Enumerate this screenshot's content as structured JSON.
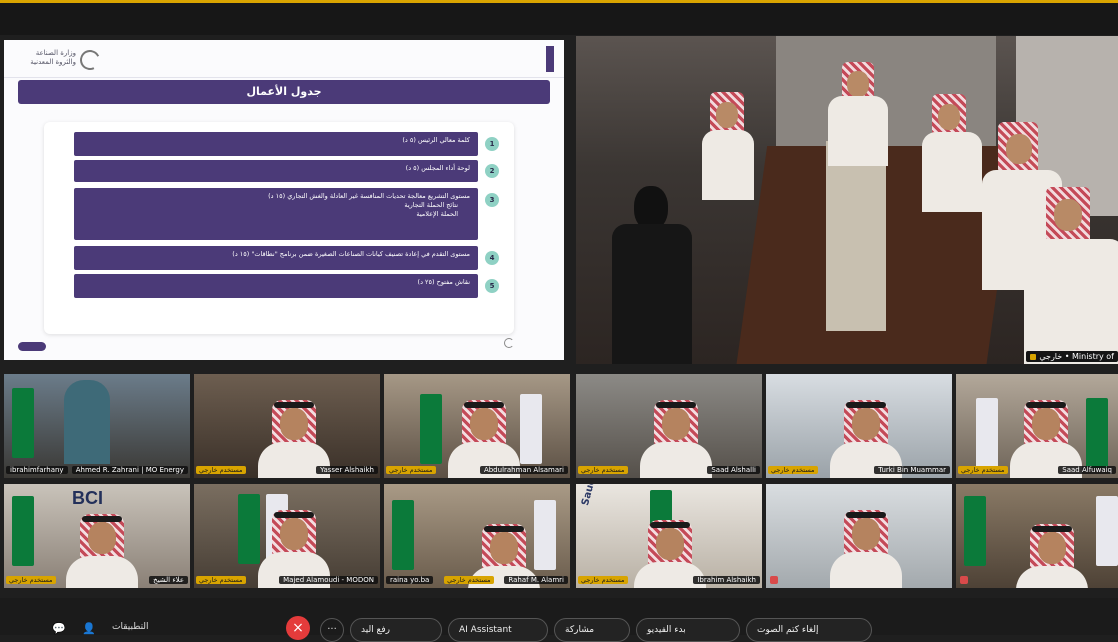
{
  "colors": {
    "accent": "#4b3a78",
    "badge": "#d8a400",
    "end_call": "#e43b3b"
  },
  "slide": {
    "logo_text_line1": "وزارة الصناعة",
    "logo_text_line2": "والثروة المعدنية",
    "title": "جدول الأعمال",
    "items": [
      {
        "num": "1",
        "text": "كلمة معالي الرئيس (٥ د)"
      },
      {
        "num": "2",
        "text": "لوحة أداء المجلس (٥ د)"
      },
      {
        "num": "3",
        "text": "مستوى التشريع معالجة تحديات المنافسة غير العادلة والغش التجاري (١٥ د)",
        "subs": [
          "نتائج الحملة التجارية",
          "الحملة الإعلامية"
        ]
      },
      {
        "num": "4",
        "text": "مستوى التقدم في إعادة تصنيف كيانات الصناعات الصغيرة ضمن برنامج \"نطاقات\" (١٥ د)"
      },
      {
        "num": "5",
        "text": "نقاش مفتوح (٢٥ د)"
      }
    ]
  },
  "main_video": {
    "label_role": "خارجي",
    "label_name": "Ministry of"
  },
  "participants": [
    {
      "name": "ibrahimfarhany",
      "role": "",
      "extra": "Ahmed R. Zahrani | MO Energy"
    },
    {
      "name": "Yasser Alshaikh",
      "role": "مستخدم خارجي"
    },
    {
      "name": "Abdulrahman Alsamari",
      "role": "مستخدم خارجي"
    },
    {
      "name": "Saad Alshalli",
      "role": "مستخدم خارجي"
    },
    {
      "name": "Turki Bin Muammar",
      "role": "مستخدم خارجي"
    },
    {
      "name": "Saad Alfuwaiq",
      "role": "مستخدم خارجي"
    },
    {
      "name": "علاء الشيخ",
      "role": "مستخدم خارجي",
      "logo": "BCI"
    },
    {
      "name": "Majed Alamoudi - MODON",
      "role": "مستخدم خارجي"
    },
    {
      "name": "Rahaf M. Alamri",
      "role": "مستخدم خارجي",
      "extra": "raina yo.ba"
    },
    {
      "name": "Ibrahim Alshaikh",
      "role": "مستخدم خارجي",
      "logo": "Saudi Ce"
    },
    {
      "name": "",
      "role": ""
    },
    {
      "name": "",
      "role": ""
    }
  ],
  "toolbar": {
    "apps_label": "التطبيقات",
    "mute_label": "إلغاء كتم الصوت",
    "video_label": "بدء الفيديو",
    "share_label": "مشاركة",
    "ai_label": "AI Assistant",
    "raise_label": "رفع اليد",
    "more_label": "···",
    "end_label": "×"
  }
}
